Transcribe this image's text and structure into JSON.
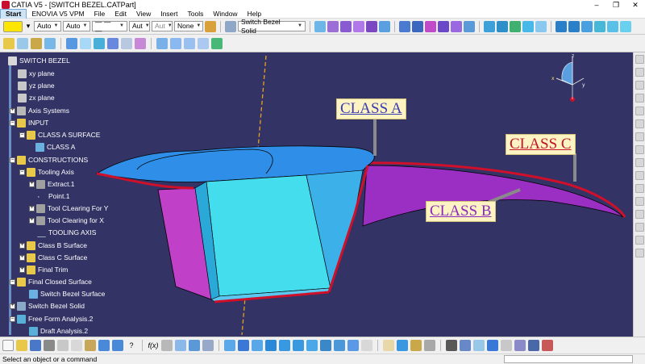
{
  "title": "CATIA V5 - [SWITCH BEZEL.CATPart]",
  "window_buttons": [
    "–",
    "❐",
    "✕"
  ],
  "menu": [
    "Start",
    "ENOVIA V5 VPM",
    "File",
    "Edit",
    "View",
    "Insert",
    "Tools",
    "Window",
    "Help"
  ],
  "toolbar1": {
    "line_type_1": "Auto",
    "line_type_2": "Auto",
    "dash_style": "— — —",
    "weight_1": "Aut",
    "weight_2": "Aut",
    "layer": "None",
    "body_selector": "Switch Bezel Solid"
  },
  "tree": {
    "root": "SWITCH BEZEL",
    "items": [
      {
        "label": "xy plane"
      },
      {
        "label": "yz plane"
      },
      {
        "label": "zx plane"
      },
      {
        "label": "Axis Systems"
      },
      {
        "label": "INPUT"
      },
      {
        "label": "CLASS A SURFACE"
      },
      {
        "label": "CLASS A"
      },
      {
        "label": "CONSTRUCTIONS"
      },
      {
        "label": "Tooling Axis"
      },
      {
        "label": "Extract.1"
      },
      {
        "label": "Point.1"
      },
      {
        "label": "Tool CLearing For Y"
      },
      {
        "label": "Tool Clearing for X"
      },
      {
        "label": "TOOLING AXIS"
      },
      {
        "label": "Class B Surface"
      },
      {
        "label": "Class C Surface"
      },
      {
        "label": "Final Trim"
      },
      {
        "label": "Final Closed Surface"
      },
      {
        "label": "Switch Bezel Surface"
      },
      {
        "label": "Switch Bezel Solid"
      },
      {
        "label": "Free Form Analysis.2"
      },
      {
        "label": "Draft Analysis.2"
      }
    ]
  },
  "callouts": {
    "class_a": "CLASS A",
    "class_b": "CLASS B",
    "class_c": "CLASS C"
  },
  "compass": {
    "z": "z",
    "x": "x",
    "y": "y"
  },
  "status": "Select an object or a command",
  "colors": {
    "viewport_bg": "#333366",
    "class_a_surface": "#2f8fe8",
    "wall_cyan": "#44ddee",
    "class_b_surface": "#9b2fc4",
    "class_c_edge": "#d0102a",
    "magenta_wall": "#c040c8",
    "tooling_axis": "#e8a020"
  }
}
